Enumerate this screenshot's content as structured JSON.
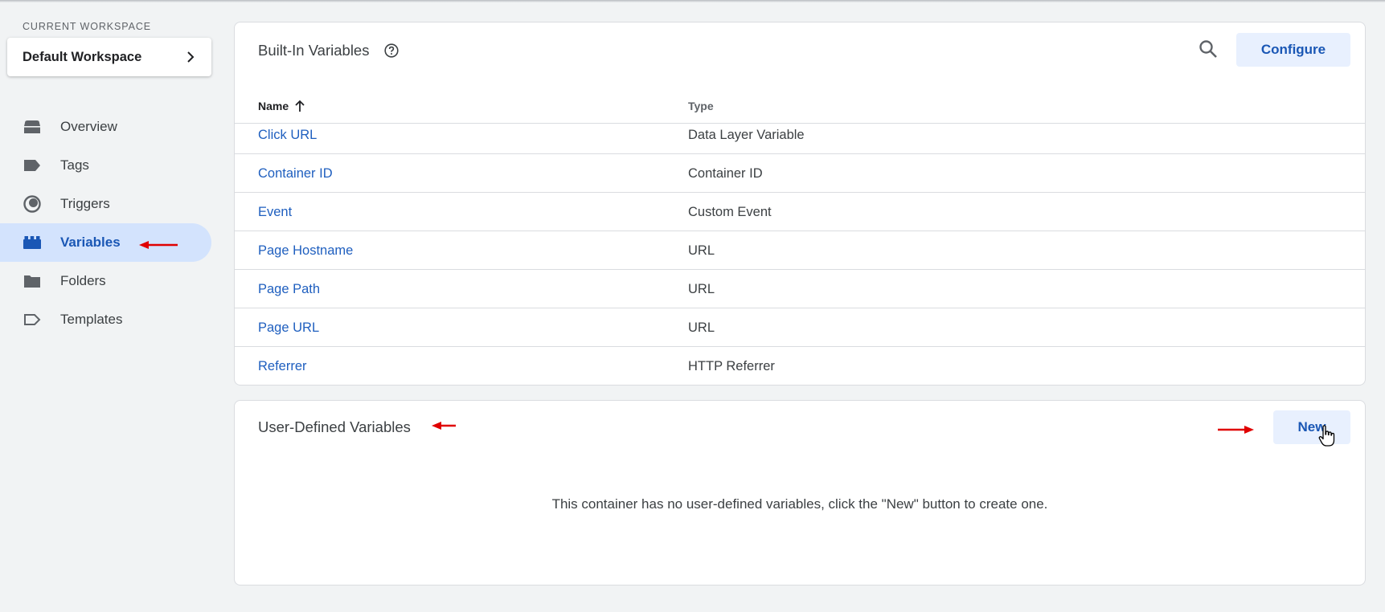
{
  "workspace": {
    "section_label": "CURRENT WORKSPACE",
    "name": "Default Workspace"
  },
  "sidebar": {
    "items": [
      {
        "label": "Overview",
        "icon": "overview-icon"
      },
      {
        "label": "Tags",
        "icon": "tag-icon"
      },
      {
        "label": "Triggers",
        "icon": "trigger-icon"
      },
      {
        "label": "Variables",
        "icon": "variables-icon",
        "active": true
      },
      {
        "label": "Folders",
        "icon": "folder-icon"
      },
      {
        "label": "Templates",
        "icon": "template-icon"
      }
    ]
  },
  "builtin": {
    "title": "Built-In Variables",
    "configure_label": "Configure",
    "columns": {
      "name": "Name",
      "type": "Type"
    },
    "rows": [
      {
        "name": "Click URL",
        "type": "Data Layer Variable"
      },
      {
        "name": "Container ID",
        "type": "Container ID"
      },
      {
        "name": "Event",
        "type": "Custom Event"
      },
      {
        "name": "Page Hostname",
        "type": "URL"
      },
      {
        "name": "Page Path",
        "type": "URL"
      },
      {
        "name": "Page URL",
        "type": "URL"
      },
      {
        "name": "Referrer",
        "type": "HTTP Referrer"
      }
    ]
  },
  "user_defined": {
    "title": "User-Defined Variables",
    "new_label": "New",
    "empty_message": "This container has no user-defined variables, click the \"New\" button to create one."
  },
  "colors": {
    "accent": "#1a57b5",
    "active_nav_bg": "#d3e3fd",
    "annotation_arrow": "#e00000"
  }
}
